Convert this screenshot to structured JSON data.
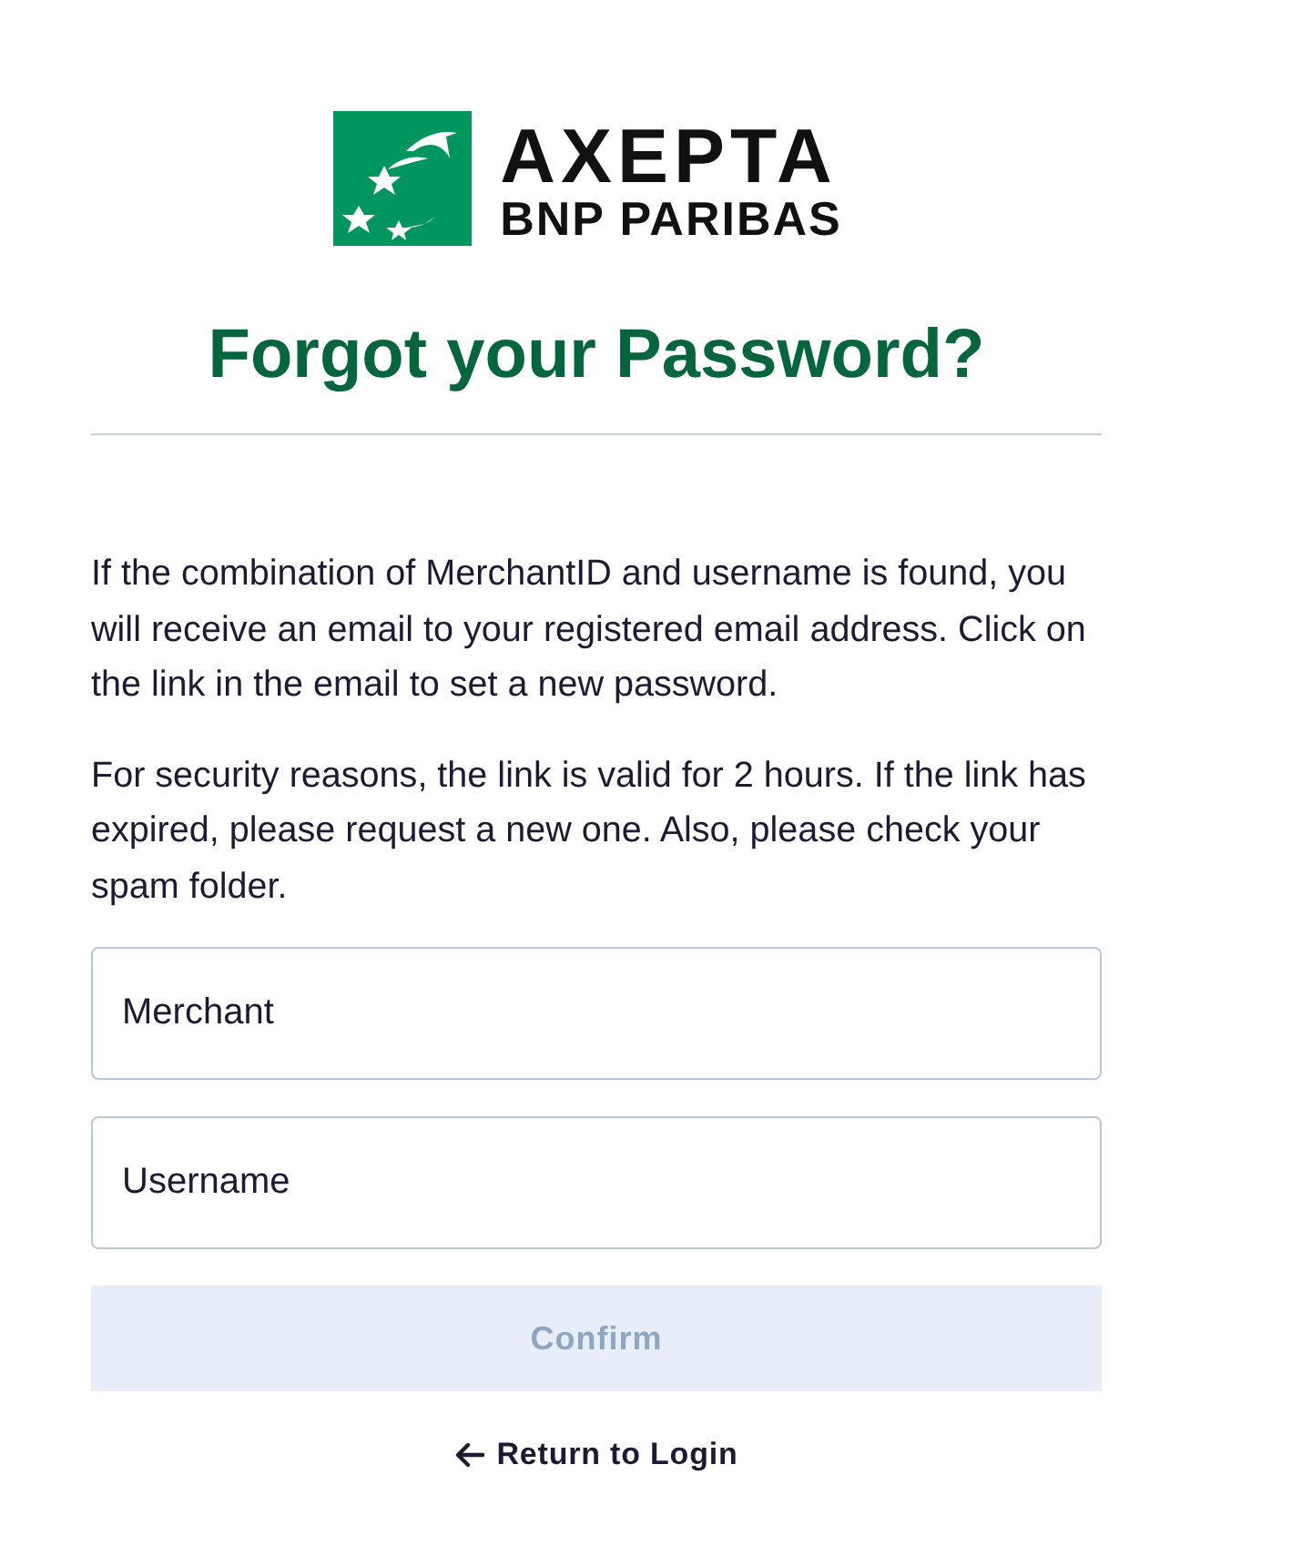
{
  "logo": {
    "brand": "AXEPTA",
    "company": "BNP PARIBAS"
  },
  "title": "Forgot your Password?",
  "paragraphs": [
    "If the combination of MerchantID and username is found, you will receive an email to your registered email address. Click on the link in the email to set a new password.",
    "For security reasons, the link is valid for 2 hours. If the link has expired, please request a new one. Also, please check your spam folder."
  ],
  "fields": [
    {
      "placeholder": "Merchant"
    },
    {
      "placeholder": "Username"
    }
  ],
  "confirm_button": {
    "label": "Confirm",
    "disabled": true
  },
  "return_link": {
    "label": "Return to Login"
  }
}
